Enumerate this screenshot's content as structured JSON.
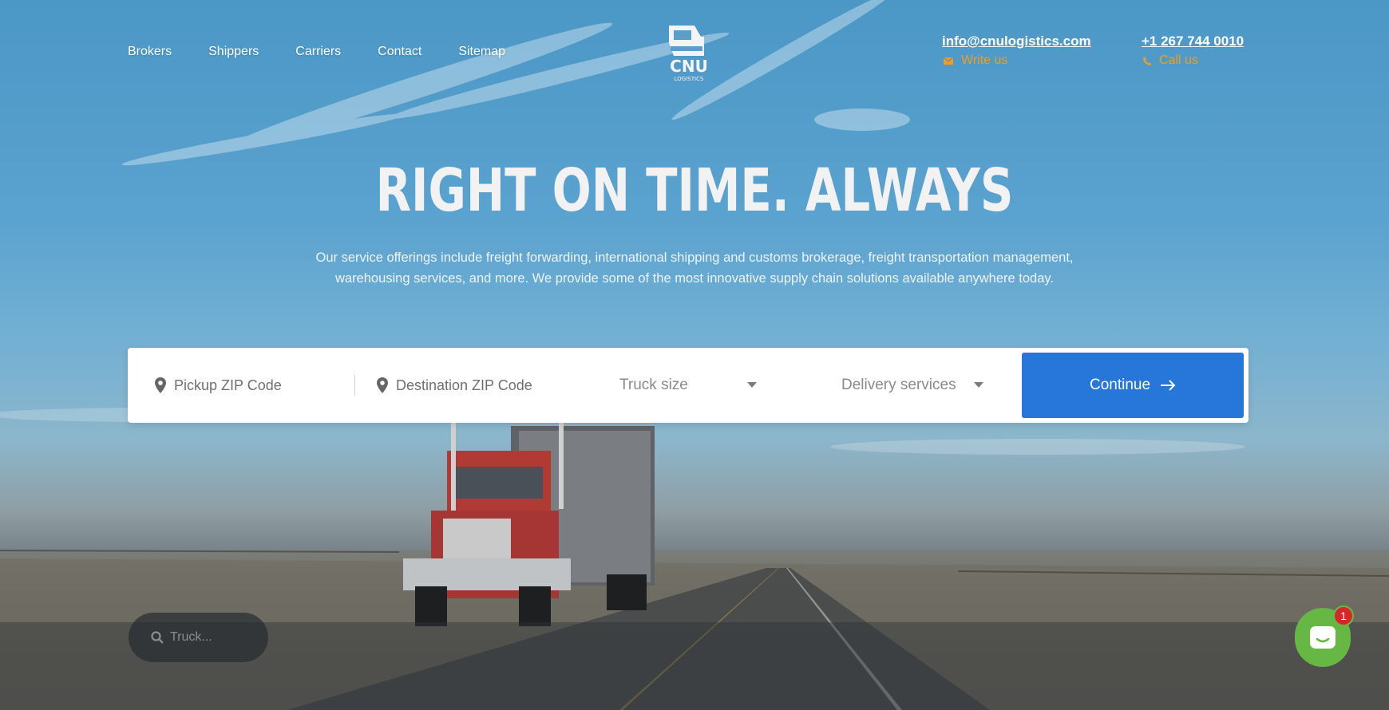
{
  "nav": {
    "items": [
      {
        "label": "Brokers"
      },
      {
        "label": "Shippers"
      },
      {
        "label": "Carriers"
      },
      {
        "label": "Contact"
      },
      {
        "label": "Sitemap"
      }
    ]
  },
  "logo": {
    "text": "CNU",
    "subtext": "LOGISTICS"
  },
  "contact": {
    "email": "info@cnulogistics.com",
    "email_action": "Write us",
    "phone": "+1 267 744 0010",
    "phone_action": "Call us",
    "accent_color": "#f39c1f"
  },
  "hero": {
    "headline": "RIGHT ON TIME. ALWAYS",
    "tagline_line1": "Our service offerings include freight forwarding, international shipping and customs brokerage, freight transportation management,",
    "tagline_line2": "warehousing services, and more. We provide some of the most innovative supply chain solutions available anywhere today."
  },
  "booking": {
    "pickup_placeholder": "Pickup ZIP Code",
    "destination_placeholder": "Destination ZIP Code",
    "truck_size_label": "Truck size",
    "delivery_services_label": "Delivery services",
    "continue_label": "Continue",
    "button_color": "#2677d9"
  },
  "truck_search": {
    "placeholder": "Truck..."
  },
  "chat": {
    "badge_count": "1",
    "color": "#67b745"
  }
}
